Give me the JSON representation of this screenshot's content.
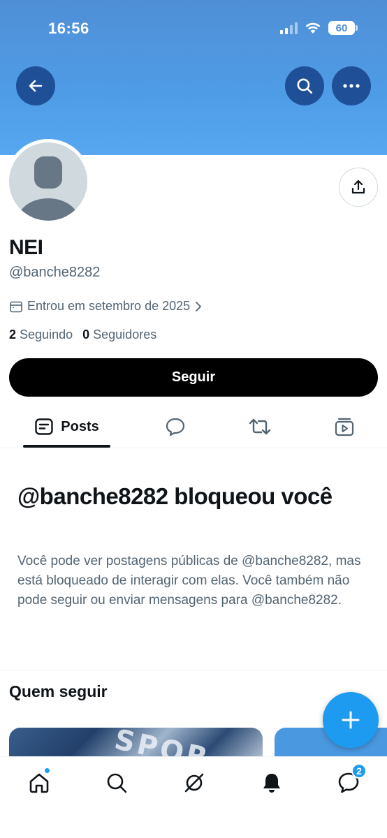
{
  "status_bar": {
    "time": "16:56",
    "battery": "60"
  },
  "profile": {
    "name": "NEI",
    "handle": "@banche8282",
    "joined": "Entrou em setembro de 2025",
    "following_count": "2",
    "following_label": "Seguindo",
    "followers_count": "0",
    "followers_label": "Seguidores",
    "follow_button": "Seguir"
  },
  "tabs": [
    {
      "label": "Posts",
      "icon": "posts-icon",
      "active": true
    },
    {
      "label": "",
      "icon": "replies-icon"
    },
    {
      "label": "",
      "icon": "reposts-icon"
    },
    {
      "label": "",
      "icon": "media-icon"
    }
  ],
  "blocked": {
    "title": "@banche8282 bloqueou você",
    "text": "Você pode ver postagens públicas de @banche8282, mas está bloqueado de interagir com elas. Você também não pode seguir ou enviar mensagens para @banche8282."
  },
  "who_to_follow": {
    "title": "Quem seguir",
    "card_text": "SPOR"
  },
  "bottom_nav": {
    "items": [
      "home-icon",
      "search-icon",
      "grok-icon",
      "notifications-icon",
      "messages-icon"
    ],
    "messages_badge": "2"
  },
  "colors": {
    "accent": "#1d9bf0",
    "header": "#4f9ce6",
    "header_button": "#1f4f97",
    "text_secondary": "#536471"
  }
}
